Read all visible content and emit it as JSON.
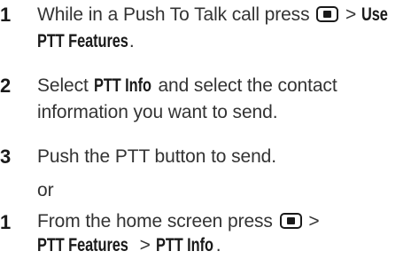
{
  "steps": [
    {
      "number": "1",
      "text_before": "While in a Push To Talk call press",
      "separator": ">",
      "menu_path_1": "Use",
      "menu_path_2": "PTT Features",
      "period": "."
    },
    {
      "number": "2",
      "text_before": "Select",
      "menu_item": "PTT Info",
      "text_after_line1": "and select the contact",
      "text_line2": "information you want to send."
    },
    {
      "number": "3",
      "text": "Push the PTT button to send."
    }
  ],
  "or_label": "or",
  "alt_step": {
    "number": "1",
    "text_before": "From the home screen press",
    "separator": ">",
    "menu_path_1": "PTT Features",
    "separator_2": ">",
    "menu_path_2": "PTT Info",
    "period": "."
  },
  "icons": {
    "menu_key": "menu-key-icon"
  }
}
